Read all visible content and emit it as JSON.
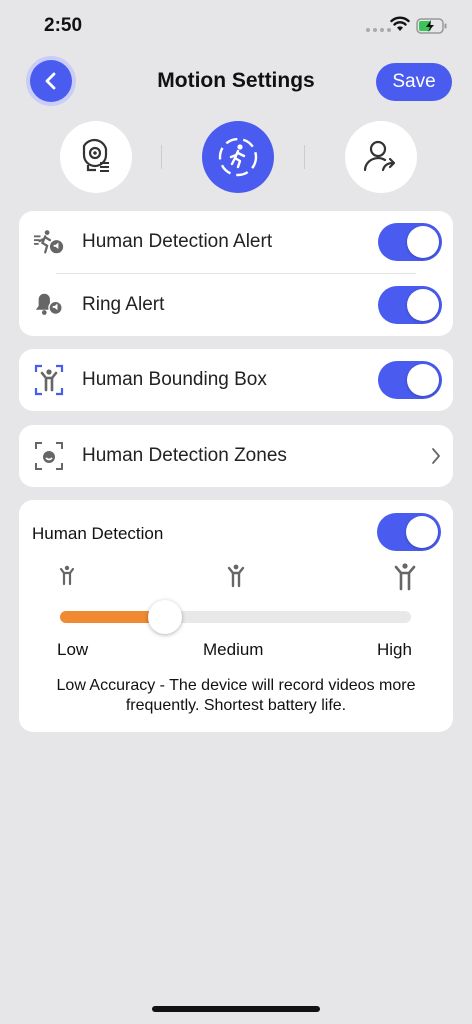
{
  "status_bar": {
    "time": "2:50"
  },
  "header": {
    "title": "Motion Settings",
    "save_label": "Save"
  },
  "mode_tabs": [
    {
      "icon": "camera-list-icon",
      "active": false
    },
    {
      "icon": "motion-person-icon",
      "active": true
    },
    {
      "icon": "person-share-icon",
      "active": false
    }
  ],
  "alerts": {
    "human_detection_alert": {
      "label": "Human Detection Alert",
      "enabled": true
    },
    "ring_alert": {
      "label": "Ring Alert",
      "enabled": true
    }
  },
  "bounding_box": {
    "label": "Human Bounding Box",
    "enabled": true
  },
  "detection_zones": {
    "label": "Human Detection Zones"
  },
  "sensitivity": {
    "title": "Human Detection",
    "enabled": true,
    "levels": [
      "Low",
      "Medium",
      "High"
    ],
    "slider_value": 0.3,
    "description": "Low Accuracy - The device will record videos more frequently. Shortest battery life."
  },
  "colors": {
    "accent": "#4a5cf0",
    "slider_fill": "#ef8a32",
    "background": "#e6e6e8"
  }
}
